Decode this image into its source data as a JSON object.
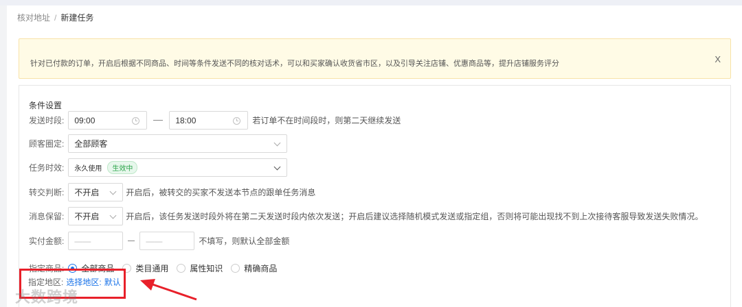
{
  "breadcrumb": {
    "parent": "核对地址",
    "separator": "/",
    "current": "新建任务"
  },
  "notice": {
    "text": "针对已付款的订单，开启后根据不同商品、时间等条件发送不同的核对话术，可以和买家确认收货省市区，以及引导关注店铺、优惠商品等，提升店铺服务评分",
    "close_label": "X"
  },
  "form": {
    "section_title": "条件设置",
    "send_time": {
      "label": "发送时段:",
      "start": "09:00",
      "end": "18:00",
      "hint": "若订单不在时间段时，则第二天继续发送"
    },
    "customer": {
      "label": "顾客圈定:",
      "value": "全部顾客"
    },
    "validity": {
      "label": "任务时效:",
      "value": "永久使用",
      "status": "生效中"
    },
    "transfer": {
      "label": "转交判断:",
      "value": "不开启",
      "hint": "开启后，被转交的买家不发送本节点的跟单任务消息"
    },
    "retain": {
      "label": "消息保留:",
      "value": "不开启",
      "hint": "开启后，该任务发送时段外将在第二天发送时段内依次发送；开启后建议选择随机模式发送或指定组，否则将可能出现找不到上次接待客服导致发送失败情况。"
    },
    "amount": {
      "label": "实付金额:",
      "min_placeholder": "——",
      "max_placeholder": "——",
      "hint": "不填写，则默认全部金额"
    },
    "product": {
      "label": "指定商品:",
      "options": [
        "全部商品",
        "类目通用",
        "属性知识",
        "精确商品"
      ],
      "selected": "全部商品"
    },
    "region": {
      "label": "指定地区:",
      "link": "选择地区:",
      "value": "默认"
    }
  },
  "annotation": {
    "color": "#e8202a"
  },
  "watermark": "大数跨境",
  "colors": {
    "accent": "#1a73e8",
    "notice_bg": "#fffbe6",
    "tag_green": "#2ba44a"
  }
}
